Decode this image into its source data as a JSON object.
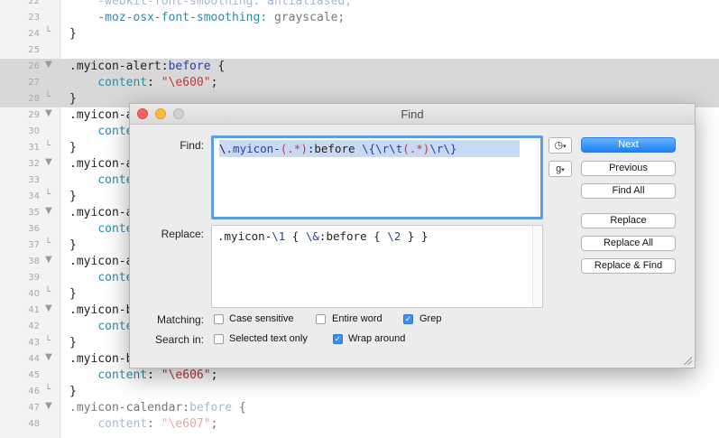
{
  "editor": {
    "lines": [
      {
        "num": "22",
        "fold": "",
        "parts": [
          [
            "    -webkit-font-smoothing: antialiased;",
            "tk-faded"
          ]
        ]
      },
      {
        "num": "23",
        "fold": "",
        "parts": [
          [
            "    -moz-osx-font-smoothing: ",
            "tk-prop"
          ],
          [
            "grayscale;",
            "tk-gray"
          ]
        ]
      },
      {
        "num": "24",
        "fold": "└",
        "parts": [
          [
            "}",
            "tk-sel"
          ]
        ]
      },
      {
        "num": "25",
        "fold": "",
        "parts": [
          [
            "",
            ""
          ]
        ]
      },
      {
        "num": "26",
        "fold": "▼",
        "hl": true,
        "parts": [
          [
            ".myicon-alert:",
            "tk-sel"
          ],
          [
            "before",
            "tk-kw"
          ],
          [
            " {",
            "tk-sel"
          ]
        ]
      },
      {
        "num": "27",
        "fold": "",
        "hl": true,
        "parts": [
          [
            "    ",
            "tk-sel"
          ],
          [
            "content",
            "tk-prop"
          ],
          [
            ": ",
            "tk-sel"
          ],
          [
            "\"\\e600\"",
            "tk-str"
          ],
          [
            ";",
            "tk-sel"
          ]
        ]
      },
      {
        "num": "28",
        "fold": "└",
        "hl": true,
        "parts": [
          [
            "}",
            "tk-sel"
          ]
        ]
      },
      {
        "num": "29",
        "fold": "▼",
        "parts": [
          [
            ".myicon-a",
            "tk-sel"
          ]
        ]
      },
      {
        "num": "30",
        "fold": "",
        "parts": [
          [
            "    ",
            "tk-sel"
          ],
          [
            "conten",
            "tk-prop"
          ]
        ]
      },
      {
        "num": "31",
        "fold": "└",
        "parts": [
          [
            "}",
            "tk-sel"
          ]
        ]
      },
      {
        "num": "32",
        "fold": "▼",
        "parts": [
          [
            ".myicon-a",
            "tk-sel"
          ]
        ]
      },
      {
        "num": "33",
        "fold": "",
        "parts": [
          [
            "    ",
            "tk-sel"
          ],
          [
            "conten",
            "tk-prop"
          ]
        ]
      },
      {
        "num": "34",
        "fold": "└",
        "parts": [
          [
            "}",
            "tk-sel"
          ]
        ]
      },
      {
        "num": "35",
        "fold": "▼",
        "parts": [
          [
            ".myicon-a",
            "tk-sel"
          ]
        ]
      },
      {
        "num": "36",
        "fold": "",
        "parts": [
          [
            "    ",
            "tk-sel"
          ],
          [
            "conten",
            "tk-prop"
          ]
        ]
      },
      {
        "num": "37",
        "fold": "└",
        "parts": [
          [
            "}",
            "tk-sel"
          ]
        ]
      },
      {
        "num": "38",
        "fold": "▼",
        "parts": [
          [
            ".myicon-a",
            "tk-sel"
          ]
        ]
      },
      {
        "num": "39",
        "fold": "",
        "parts": [
          [
            "    ",
            "tk-sel"
          ],
          [
            "conten",
            "tk-prop"
          ]
        ]
      },
      {
        "num": "40",
        "fold": "└",
        "parts": [
          [
            "}",
            "tk-sel"
          ]
        ]
      },
      {
        "num": "41",
        "fold": "▼",
        "parts": [
          [
            ".myicon-b",
            "tk-sel"
          ]
        ]
      },
      {
        "num": "42",
        "fold": "",
        "parts": [
          [
            "    ",
            "tk-sel"
          ],
          [
            "conten",
            "tk-prop"
          ]
        ]
      },
      {
        "num": "43",
        "fold": "└",
        "parts": [
          [
            "}",
            "tk-sel"
          ]
        ]
      },
      {
        "num": "44",
        "fold": "▼",
        "parts": [
          [
            ".myicon-b",
            "tk-sel"
          ]
        ]
      },
      {
        "num": "45",
        "fold": "",
        "parts": [
          [
            "    ",
            "tk-sel"
          ],
          [
            "content",
            "tk-prop"
          ],
          [
            ": ",
            "tk-sel"
          ],
          [
            "\"\\e606\"",
            "tk-str"
          ],
          [
            ";",
            "tk-sel"
          ]
        ]
      },
      {
        "num": "46",
        "fold": "└",
        "parts": [
          [
            "}",
            "tk-sel"
          ]
        ]
      },
      {
        "num": "47",
        "fold": "▼",
        "parts": [
          [
            ".myicon-calendar:",
            "tk-gray"
          ],
          [
            "before",
            "tk-faded"
          ],
          [
            " {",
            "tk-gray"
          ]
        ]
      },
      {
        "num": "48",
        "fold": "",
        "parts": [
          [
            "    ",
            "tk-sel"
          ],
          [
            "content",
            "tk-faded"
          ],
          [
            ": ",
            "tk-gray"
          ],
          [
            "\"\\e607\"",
            "tk-faded-str"
          ],
          [
            ";",
            "tk-gray"
          ]
        ]
      }
    ]
  },
  "find_dialog": {
    "title": "Find",
    "find_label": "Find:",
    "find_parts": [
      [
        "\\",
        "tk-sel"
      ],
      [
        ".myicon-",
        "tk-kw"
      ],
      [
        "(.*)",
        "tk-str"
      ],
      [
        ":before ",
        "tk-sel"
      ],
      [
        "\\{\\r\\t",
        "tk-kw"
      ],
      [
        "(.*)",
        "tk-str"
      ],
      [
        "\\r\\}",
        "tk-kw"
      ]
    ],
    "replace_label": "Replace:",
    "replace_parts": [
      [
        ".myicon-",
        "tk-sel"
      ],
      [
        "\\1",
        "tk-kw"
      ],
      [
        " { ",
        "tk-sel"
      ],
      [
        "\\&",
        "tk-kw"
      ],
      [
        ":before { ",
        "tk-sel"
      ],
      [
        "\\2",
        "tk-kw"
      ],
      [
        " } }",
        "tk-sel"
      ]
    ],
    "history_icon": "clock-icon",
    "grep_popup": "g",
    "buttons": {
      "next": "Next",
      "previous": "Previous",
      "find_all": "Find All",
      "replace": "Replace",
      "replace_all": "Replace All",
      "replace_find": "Replace & Find"
    },
    "matching_label": "Matching:",
    "search_in_label": "Search in:",
    "options": {
      "case_sensitive": {
        "label": "Case sensitive",
        "checked": false
      },
      "entire_word": {
        "label": "Entire word",
        "checked": false
      },
      "grep": {
        "label": "Grep",
        "checked": true
      },
      "selected_text_only": {
        "label": "Selected text only",
        "checked": false
      },
      "wrap_around": {
        "label": "Wrap around",
        "checked": true
      }
    }
  }
}
